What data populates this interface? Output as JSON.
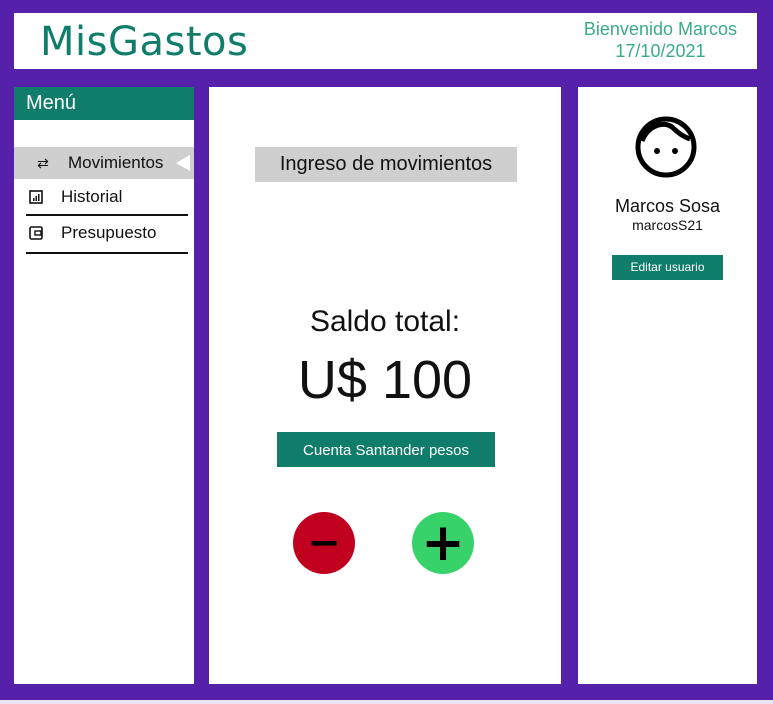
{
  "header": {
    "app_title": "MisGastos",
    "welcome": "Bienvenido Marcos",
    "date": "17/10/2021"
  },
  "sidebar": {
    "title": "Menú",
    "items": [
      {
        "label": "Movimientos",
        "icon": "swap-arrows-icon",
        "active": true
      },
      {
        "label": "Historial",
        "icon": "chart-icon",
        "active": false
      },
      {
        "label": "Presupuesto",
        "icon": "wallet-icon",
        "active": false
      }
    ]
  },
  "main": {
    "section_title": "Ingreso de movimientos",
    "balance_label": "Saldo total:",
    "balance_value": "U$ 100",
    "account_button": "Cuenta Santander pesos",
    "minus_label": "−",
    "plus_label": "+"
  },
  "profile": {
    "name": "Marcos Sosa",
    "username": "marcosS21",
    "edit_button": "Editar usuario"
  },
  "colors": {
    "frame": "#5520aa",
    "accent": "#0f7d6a",
    "minus": "#c1001f",
    "plus": "#38d26b"
  }
}
